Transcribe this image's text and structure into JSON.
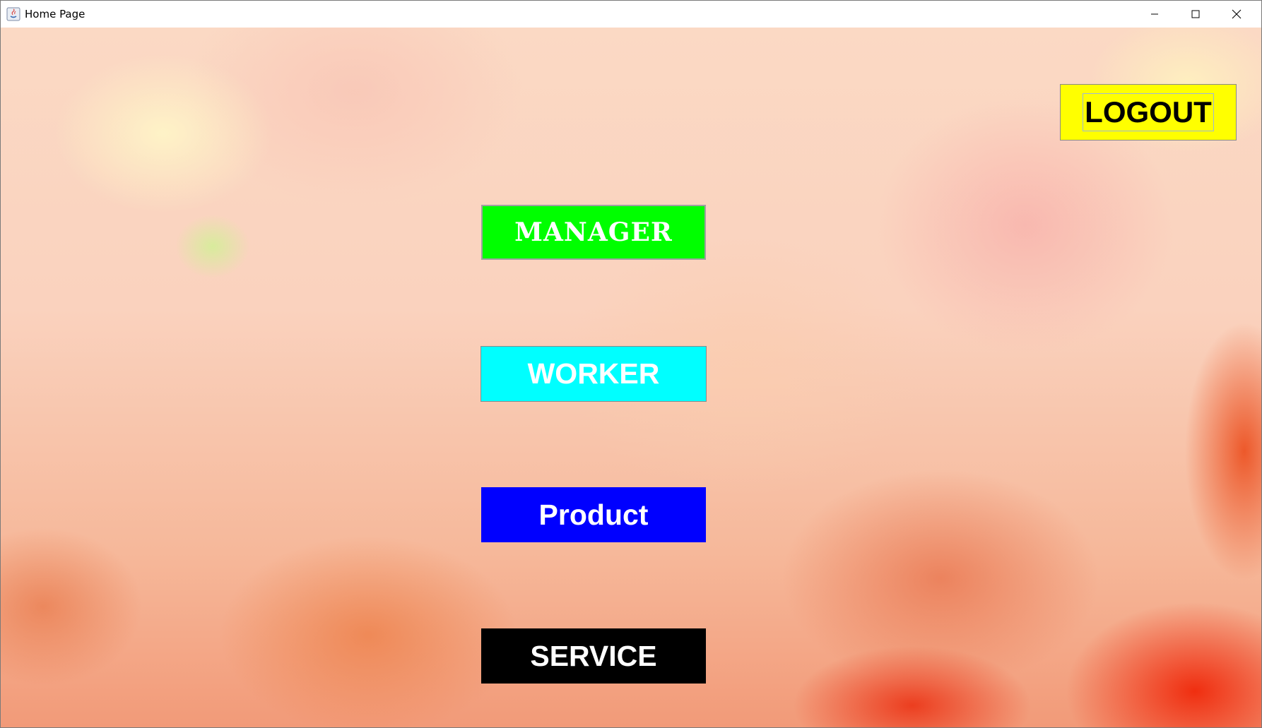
{
  "window": {
    "title": "Home Page"
  },
  "buttons": {
    "logout": "LOGOUT",
    "manager": "MANAGER",
    "worker": "WORKER",
    "product": "Product",
    "service": "SERVICE"
  },
  "colors": {
    "manager": "#00ff00",
    "worker": "#00ffff",
    "product": "#0000ff",
    "service": "#000000",
    "logout": "#ffff00"
  },
  "icons": {
    "app": "java-app-icon",
    "minimize": "minimize-icon",
    "maximize": "maximize-icon",
    "close": "close-icon"
  }
}
